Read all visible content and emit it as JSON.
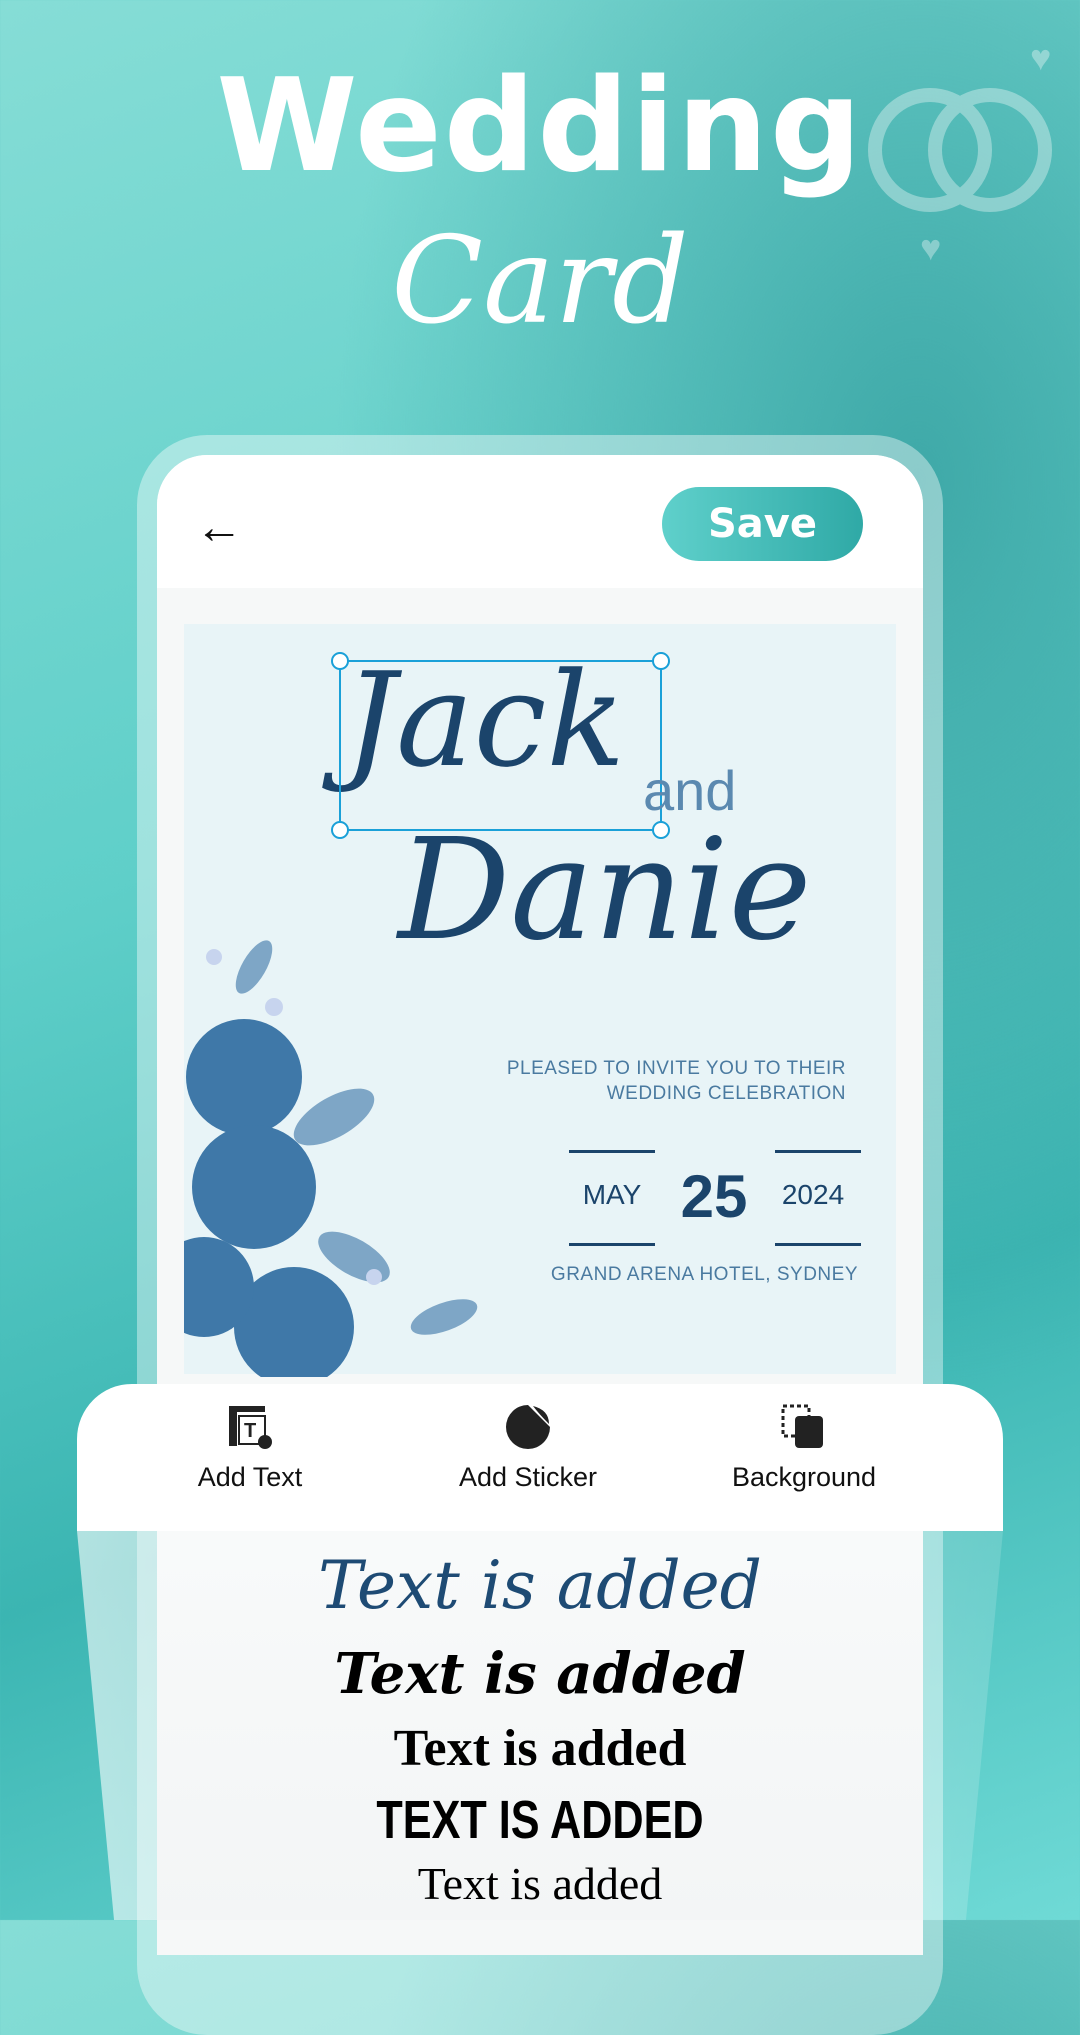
{
  "hero": {
    "title_line1": "Wedding",
    "title_line2": "Card"
  },
  "header": {
    "back_icon": "arrow-left-icon",
    "save_label": "Save"
  },
  "card": {
    "name1": "Jack",
    "connector": "and",
    "name2": "Danie",
    "invite_line1": "PLEASED TO INVITE YOU TO THEIR",
    "invite_line2": "WEDDING CELEBRATION",
    "month": "MAY",
    "day": "25",
    "year": "2024",
    "venue": "GRAND ARENA HOTEL, SYDNEY"
  },
  "toolbar": {
    "items": [
      {
        "label": "Add Text",
        "icon": "add-text-icon"
      },
      {
        "label": "Add Sticker",
        "icon": "sticker-icon"
      },
      {
        "label": "Background",
        "icon": "background-icon"
      }
    ]
  },
  "samples": [
    "Text is added",
    "Text is added",
    "Text is added",
    "TEXT IS ADDED",
    "Text is added"
  ],
  "colors": {
    "accent": "#2fa9a6",
    "ink": "#1b446b",
    "selection": "#1aa0d8"
  }
}
